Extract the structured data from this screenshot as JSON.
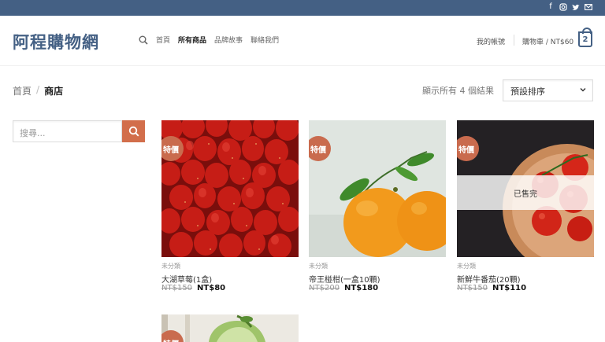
{
  "header": {
    "logo": "阿程購物網",
    "nav": [
      "首頁",
      "所有商品",
      "品牌故事",
      "聯絡我們"
    ],
    "account": "我的帳號",
    "cart_label": "購物車 / NT$60",
    "cart_count": "2"
  },
  "social_icons": [
    "facebook-icon",
    "instagram-icon",
    "twitter-icon",
    "mail-icon"
  ],
  "breadcrumb": {
    "home": "首頁",
    "sep": "/",
    "current": "商店"
  },
  "result_count": "顯示所有 4 個結果",
  "sort": {
    "selected": "預設排序"
  },
  "search": {
    "placeholder": "搜尋..."
  },
  "products": [
    {
      "badge": "特價",
      "category": "未分類",
      "name": "大湖草莓(1盒)",
      "old_price": "NT$150",
      "price": "NT$80"
    },
    {
      "badge": "特價",
      "category": "未分類",
      "name": "帝王椪柑(一盒10顆)",
      "old_price": "NT$200",
      "price": "NT$180"
    },
    {
      "badge": "特價",
      "category": "未分類",
      "name": "新鮮牛番茄(20顆)",
      "old_price": "NT$150",
      "price": "NT$110",
      "overlay": "已售完"
    },
    {
      "badge": "特價"
    }
  ],
  "colors": {
    "primary": "#446084",
    "accent": "#d26e4b",
    "badge": "#c96b4e"
  }
}
